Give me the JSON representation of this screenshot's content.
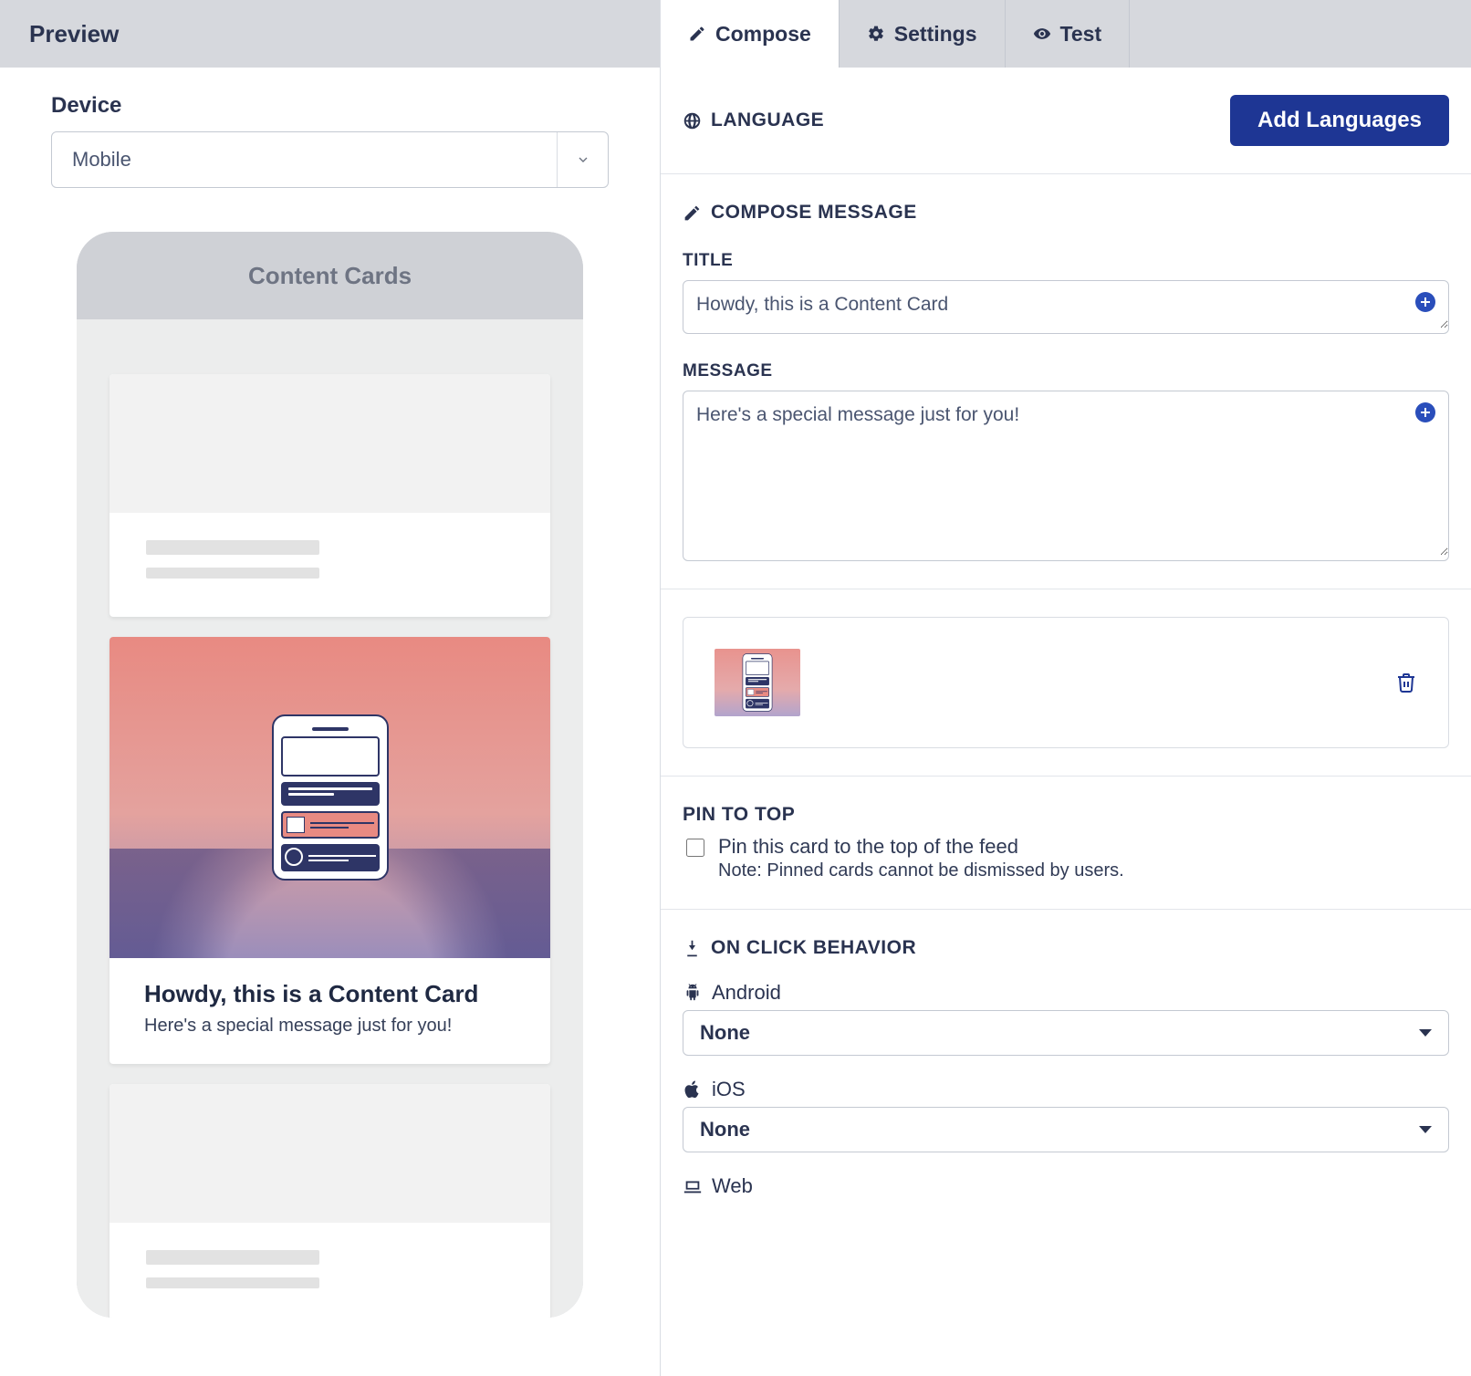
{
  "preview": {
    "header": "Preview",
    "device_label": "Device",
    "device_value": "Mobile",
    "phone_header": "Content Cards",
    "card_title": "Howdy, this is a Content Card",
    "card_message": "Here's a special message just for you!"
  },
  "tabs": {
    "compose": "Compose",
    "settings": "Settings",
    "test": "Test"
  },
  "language": {
    "header": "LANGUAGE",
    "add_button": "Add Languages"
  },
  "compose": {
    "header": "COMPOSE MESSAGE",
    "title_label": "TITLE",
    "title_value": "Howdy, this is a Content Card",
    "message_label": "MESSAGE",
    "message_value": "Here's a special message just for you!"
  },
  "pin": {
    "header": "PIN TO TOP",
    "checkbox_label": "Pin this card to the top of the feed",
    "note": "Note: Pinned cards cannot be dismissed by users."
  },
  "click": {
    "header": "ON CLICK BEHAVIOR",
    "android_label": "Android",
    "android_value": "None",
    "ios_label": "iOS",
    "ios_value": "None",
    "web_label": "Web"
  }
}
